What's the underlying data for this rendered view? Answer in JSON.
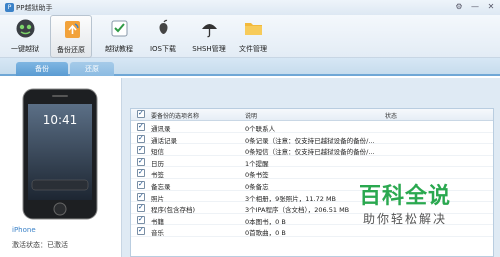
{
  "window": {
    "title": "PP越狱助手",
    "controls": [
      "⚙",
      "—",
      "✕"
    ]
  },
  "toolbar": {
    "items": [
      {
        "label": "一键越狱",
        "icon": "jailbreak-icon"
      },
      {
        "label": "备份还原",
        "icon": "backup-restore-icon",
        "active": true
      },
      {
        "label": "越狱教程",
        "icon": "tutorial-icon"
      },
      {
        "label": "IOS下载",
        "icon": "ios-download-icon"
      },
      {
        "label": "SHSH管理",
        "icon": "shsh-umbrella-icon"
      },
      {
        "label": "文件管理",
        "icon": "folder-icon"
      }
    ]
  },
  "tabs": [
    {
      "label": "备份",
      "active": true
    },
    {
      "label": "还原",
      "active": false
    }
  ],
  "device": {
    "name": "iPhone",
    "status": "激活状态：已激活",
    "screen_time": "10:41"
  },
  "table": {
    "headers": {
      "item": "要备份的选项名称",
      "desc": "说明",
      "status": "状态"
    },
    "rows": [
      {
        "name": "通讯录",
        "desc": "0个联系人"
      },
      {
        "name": "通话记录",
        "desc": "0条记录（注意：仅支持已越狱设备的备份/..."
      },
      {
        "name": "短信",
        "desc": "0条短信（注意：仅支持已越狱设备的备份/..."
      },
      {
        "name": "日历",
        "desc": "1个提醒"
      },
      {
        "name": "书签",
        "desc": "0条书签"
      },
      {
        "name": "备忘录",
        "desc": "0条备忘"
      },
      {
        "name": "照片",
        "desc": "3个相册，9张照片，11.72 MB"
      },
      {
        "name": "程序(包含存档)",
        "desc": "3个IPA程序（含文档），206.51 MB"
      },
      {
        "name": "书籍",
        "desc": "0本图书，0 B"
      },
      {
        "name": "音乐",
        "desc": "0首歌曲，0 B"
      }
    ]
  },
  "watermark": {
    "line1": "百科全说",
    "line2": "助你轻松解决"
  },
  "colors": {
    "accent": "#5a9bd2",
    "panel_bg": "#dfeaf4",
    "watermark_green": "#2aa84f"
  }
}
